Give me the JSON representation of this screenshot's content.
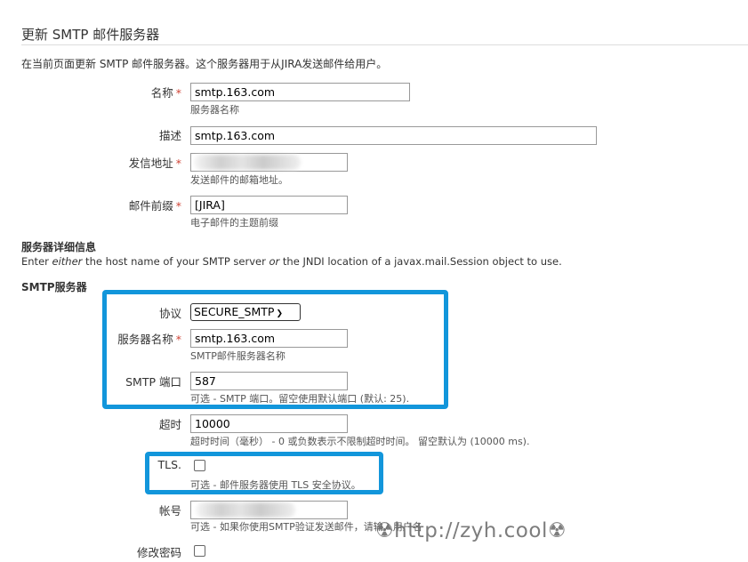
{
  "header": {
    "title": "更新 SMTP 邮件服务器",
    "intro": "在当前页面更新 SMTP 邮件服务器。这个服务器用于从JIRA发送邮件给用户。"
  },
  "form": {
    "required_marker": "*",
    "name": {
      "label": "名称",
      "value": "smtp.163.com",
      "hint": "服务器名称"
    },
    "description": {
      "label": "描述",
      "value": "smtp.163.com"
    },
    "from_address": {
      "label": "发信地址",
      "value": "",
      "hint": "发送邮件的邮箱地址。"
    },
    "prefix": {
      "label": "邮件前缀",
      "value": "[JIRA]",
      "hint": "电子邮件的主题前缀"
    }
  },
  "server_details": {
    "heading": "服务器详细信息",
    "desc_part1": "Enter ",
    "desc_em1": "either",
    "desc_part2": " the host name of your SMTP server ",
    "desc_em2": "or",
    "desc_part3": " the JNDI location of a javax.mail.Session object to use."
  },
  "smtp": {
    "heading": "SMTP服务器",
    "protocol": {
      "label": "协议",
      "selected": "SECURE_SMTP"
    },
    "hostname": {
      "label": "服务器名称",
      "value": "smtp.163.com",
      "hint": "SMTP邮件服务器名称"
    },
    "port": {
      "label": "SMTP 端口",
      "value": "587",
      "hint": "可选 - SMTP 端口。留空使用默认端口 (默认: 25)."
    },
    "timeout": {
      "label": "超时",
      "value": "10000",
      "hint": "超时时间（毫秒） - 0 或负数表示不限制超时时间。 留空默认为 (10000 ms)."
    },
    "tls": {
      "label": "TLS.",
      "checked": false,
      "hint": "可选 - 邮件服务器使用 TLS 安全协议。"
    },
    "username": {
      "label": "帐号",
      "value": "",
      "hint": "可选 - 如果你使用SMTP验证发送邮件，请输入用户名"
    },
    "change_password": {
      "label": "修改密码",
      "checked": false
    }
  },
  "watermark": "☢http://zyh.cool☢",
  "colors": {
    "highlight": "#1296db",
    "required": "#d04437"
  }
}
